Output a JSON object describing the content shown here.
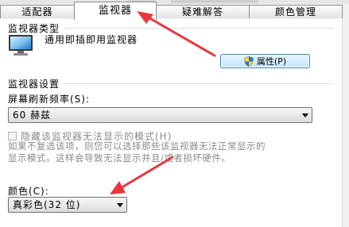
{
  "tabs": [
    {
      "label": "适配器",
      "active": false
    },
    {
      "label": "监视器",
      "active": true
    },
    {
      "label": "疑难解答",
      "active": false
    },
    {
      "label": "颜色管理",
      "active": false
    }
  ],
  "monitor_type": {
    "title": "监视器类型",
    "monitor_name": "通用即插即用监视器",
    "properties_button": "属性(P)"
  },
  "monitor_settings": {
    "title": "监视器设置",
    "refresh_label": "屏幕刷新频率(S):",
    "refresh_value": "60 赫兹",
    "hide_modes_label": "隐藏该监视器无法显示的模式(H)",
    "hide_modes_checked": false,
    "hint_line1": "如果不复选该项，则您可以选择那些该监视器无法正常显示的",
    "hint_line2": "显示模式。这样会导致无法显示并且/或者损坏硬件。"
  },
  "colors": {
    "label": "颜色(C):",
    "value": "真彩色(32 位)"
  },
  "annotation_color": "#e8383d"
}
